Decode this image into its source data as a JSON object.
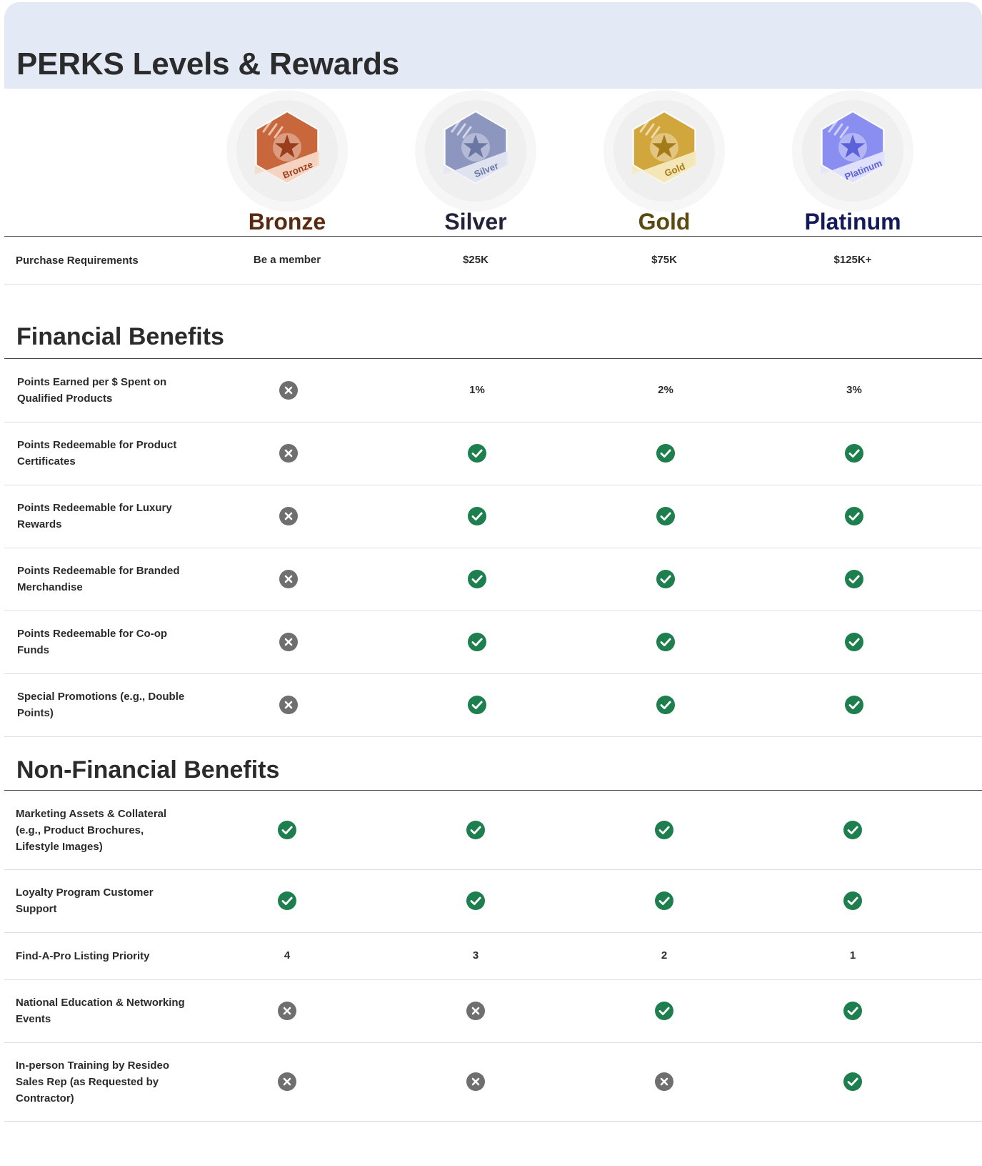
{
  "title": "PERKS Levels & Rewards",
  "colors": {
    "header_bg": "#e3e9f5",
    "check": "#1e7f4e",
    "cross": "#6f6f6f"
  },
  "tiers": [
    {
      "name": "Bronze",
      "badge_text": "Bronze",
      "name_color": "#5a2a10",
      "badge_main": "#c9673c",
      "badge_light": "#f7d9c8",
      "star": "#9a3d1c"
    },
    {
      "name": "Silver",
      "badge_text": "Silver",
      "name_color": "#22223a",
      "badge_main": "#8c96bf",
      "badge_light": "#e4e7f2",
      "star": "#6b76a3"
    },
    {
      "name": "Gold",
      "badge_text": "Gold",
      "name_color": "#5b4a10",
      "badge_main": "#d1a63c",
      "badge_light": "#f6e9bd",
      "star": "#a37b1a"
    },
    {
      "name": "Platinum",
      "badge_text": "Platinum",
      "name_color": "#14195a",
      "badge_main": "#8a8ef0",
      "badge_light": "#e4e5fc",
      "star": "#5b61d6"
    }
  ],
  "purchase": {
    "label": "Purchase Requirements",
    "values": [
      "Be a member",
      "$25K",
      "$75K",
      "$125K+"
    ]
  },
  "sections": [
    {
      "title": "Financial Benefits",
      "rows": [
        {
          "label": "Points Earned per $ Spent on Qualified Products",
          "values": [
            "cross",
            "1%",
            "2%",
            "3%"
          ]
        },
        {
          "label": "Points Redeemable for Product Certificates",
          "values": [
            "cross",
            "check",
            "check",
            "check"
          ]
        },
        {
          "label": "Points Redeemable for Luxury Rewards",
          "values": [
            "cross",
            "check",
            "check",
            "check"
          ]
        },
        {
          "label": "Points Redeemable for Branded Merchandise",
          "values": [
            "cross",
            "check",
            "check",
            "check"
          ]
        },
        {
          "label": "Points Redeemable for Co-op Funds",
          "values": [
            "cross",
            "check",
            "check",
            "check"
          ]
        },
        {
          "label": "Special Promotions (e.g., Double Points)",
          "values": [
            "cross",
            "check",
            "check",
            "check"
          ]
        }
      ]
    },
    {
      "title": "Non-Financial Benefits",
      "rows": [
        {
          "label": "Marketing Assets & Collateral (e.g., Product Brochures, Lifestyle Images)",
          "values": [
            "check",
            "check",
            "check",
            "check"
          ]
        },
        {
          "label": "Loyalty Program Customer Support",
          "values": [
            "check",
            "check",
            "check",
            "check"
          ]
        },
        {
          "label": "Find-A-Pro Listing Priority",
          "values": [
            "4",
            "3",
            "2",
            "1"
          ]
        },
        {
          "label": "National Education & Networking Events",
          "values": [
            "cross",
            "cross",
            "check",
            "check"
          ]
        },
        {
          "label": "In-person Training by Resideo Sales Rep (as Requested by Contractor)",
          "values": [
            "cross",
            "cross",
            "cross",
            "check"
          ]
        }
      ]
    }
  ]
}
